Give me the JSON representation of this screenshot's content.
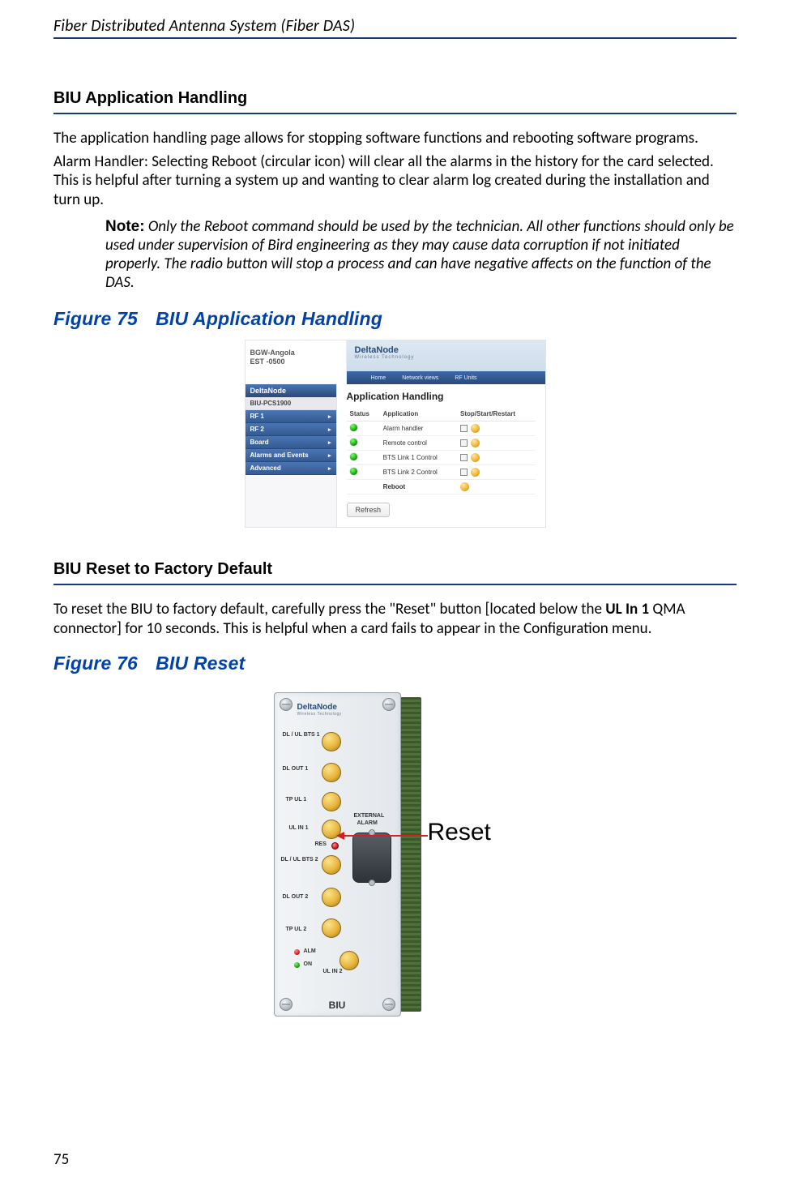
{
  "running_head": "Fiber Distributed Antenna System (Fiber DAS)",
  "page_number": "75",
  "section1": {
    "heading": "BIU Application Handling",
    "para1": "The application handling page allows for stopping software functions and rebooting software programs.",
    "para2": "Alarm Handler: Selecting Reboot (circular icon) will clear all the alarms in the history for the card selected. This is helpful after turning a system up and wanting to clear alarm log created during the installation and turn up.",
    "note_label": "Note:",
    "note_body": "Only the Reboot command should be used by the technician. All other functions should only be used under supervision of Bird engineering as they may cause data corruption if not initiated properly. The radio button will stop a process and can have negative affects on the function of the DAS."
  },
  "figure75": {
    "title_num": "Figure 75",
    "title_text": "BIU Application Handling",
    "top_left_line1": "BGW-Angola",
    "top_left_line2": "EST -0500",
    "brand": "DeltaNode",
    "brand_sub": "Wireless Technology",
    "tabs": [
      "Home",
      "Network views",
      "RF Units"
    ],
    "side_brand": "DeltaNode",
    "side_selected": "BIU-PCS1900",
    "side_items": [
      "RF 1",
      "RF 2",
      "Board",
      "Alarms and Events",
      "Advanced"
    ],
    "panel_title": "Application Handling",
    "columns": [
      "Status",
      "Application",
      "Stop/Start/Restart"
    ],
    "rows": [
      {
        "app": "Alarm handler"
      },
      {
        "app": "Remote control"
      },
      {
        "app": "BTS Link 1 Control"
      },
      {
        "app": "BTS Link 2 Control"
      }
    ],
    "reboot_label": "Reboot",
    "refresh_label": "Refresh"
  },
  "section2": {
    "heading": "BIU Reset to Factory Default",
    "para_pre": "To reset the BIU to factory default, carefully press the \"Reset\" button [located below the ",
    "para_bold": "UL In 1",
    "para_post": " QMA connector] for 10 seconds. This is helpful when a card fails to appear in the Configuration menu."
  },
  "figure76": {
    "title_num": "Figure 76",
    "title_text": "BIU Reset",
    "brand": "DeltaNode",
    "brand_sub": "Wireless Technology",
    "labels": {
      "dl_ul_bts1": "DL / UL BTS 1",
      "dl_out1": "DL OUT 1",
      "tp_ul1": "TP UL 1",
      "ul_in1": "UL IN 1",
      "ext_alarm1": "EXTERNAL",
      "ext_alarm2": "ALARM",
      "res": "RES",
      "dl_ul_bts2": "DL / UL BTS 2",
      "dl_out2": "DL OUT 2",
      "tp_ul2": "TP UL 2",
      "alm": "ALM",
      "on": "ON",
      "ul_in2": "UL IN 2",
      "footer": "BIU"
    },
    "callout": "Reset"
  }
}
